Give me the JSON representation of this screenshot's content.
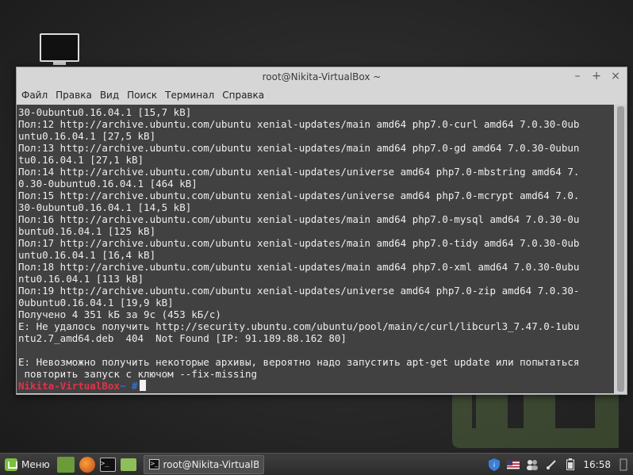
{
  "window": {
    "title": "root@Nikita-VirtualBox ~",
    "controls": [
      "–",
      "+",
      "×"
    ]
  },
  "menu": [
    "Файл",
    "Правка",
    "Вид",
    "Поиск",
    "Терминал",
    "Справка"
  ],
  "terminal": {
    "lines": [
      "30-0ubuntu0.16.04.1 [15,7 kB]",
      "Пол:12 http://archive.ubuntu.com/ubuntu xenial-updates/main amd64 php7.0-curl amd64 7.0.30-0ub",
      "untu0.16.04.1 [27,5 kB]",
      "Пол:13 http://archive.ubuntu.com/ubuntu xenial-updates/main amd64 php7.0-gd amd64 7.0.30-0ubun",
      "tu0.16.04.1 [27,1 kB]",
      "Пол:14 http://archive.ubuntu.com/ubuntu xenial-updates/universe amd64 php7.0-mbstring amd64 7.",
      "0.30-0ubuntu0.16.04.1 [464 kB]",
      "Пол:15 http://archive.ubuntu.com/ubuntu xenial-updates/universe amd64 php7.0-mcrypt amd64 7.0.",
      "30-0ubuntu0.16.04.1 [14,5 kB]",
      "Пол:16 http://archive.ubuntu.com/ubuntu xenial-updates/main amd64 php7.0-mysql amd64 7.0.30-0u",
      "buntu0.16.04.1 [125 kB]",
      "Пол:17 http://archive.ubuntu.com/ubuntu xenial-updates/main amd64 php7.0-tidy amd64 7.0.30-0ub",
      "untu0.16.04.1 [16,4 kB]",
      "Пол:18 http://archive.ubuntu.com/ubuntu xenial-updates/main amd64 php7.0-xml amd64 7.0.30-0ubu",
      "ntu0.16.04.1 [113 kB]",
      "Пол:19 http://archive.ubuntu.com/ubuntu xenial-updates/universe amd64 php7.0-zip amd64 7.0.30-",
      "0ubuntu0.16.04.1 [19,9 kB]",
      "Получено 4 351 kБ за 9с (453 kБ/c)",
      "E: Не удалось получить http://security.ubuntu.com/ubuntu/pool/main/c/curl/libcurl3_7.47.0-1ubu",
      "ntu2.7_amd64.deb  404  Not Found [IP: 91.189.88.162 80]",
      "",
      "E: Невозможно получить некоторые архивы, вероятно надо запустить apt-get update или попытаться",
      " повторить запуск с ключом --fix-missing"
    ],
    "prompt_host": "Nikita-VirtualBox",
    "prompt_path": " ~ #"
  },
  "taskbar": {
    "menu_label": "Меню",
    "task_label": "root@Nikita-VirtualB...",
    "clock": "16:58"
  }
}
